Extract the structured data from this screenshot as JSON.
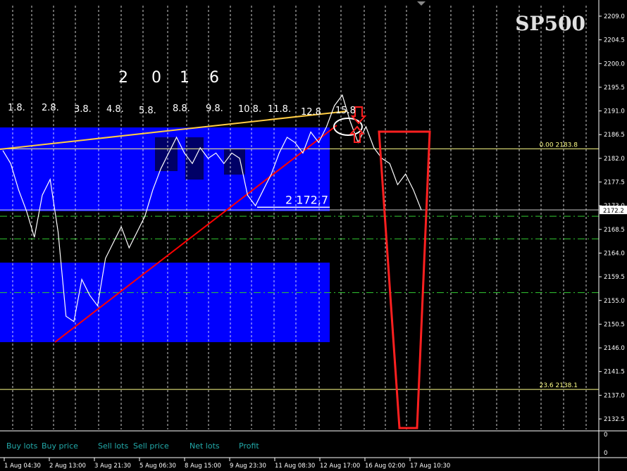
{
  "chart_data": {
    "type": "line",
    "symbol": "SP500",
    "year_label": [
      "2",
      "0",
      "1",
      "6"
    ],
    "ylim": [
      2130.5,
      2211.0
    ],
    "y_ticks": [
      2209.0,
      2204.5,
      2200.0,
      2195.5,
      2191.0,
      2186.5,
      2182.0,
      2177.5,
      2173.0,
      2168.5,
      2164.0,
      2159.5,
      2155.0,
      2150.5,
      2146.0,
      2141.5,
      2137.0,
      2132.5
    ],
    "current_price": "2172.2",
    "x_labels": [
      "1 Aug 04:30",
      "2 Aug 13:00",
      "3 Aug 21:30",
      "5 Aug 06:30",
      "8 Aug 15:00",
      "9 Aug 23:30",
      "11 Aug 08:30",
      "12 Aug 17:00",
      "16 Aug 02:00",
      "17 Aug 10:30"
    ],
    "date_marks": [
      "1.8.",
      "2.8.",
      "3.8.",
      "4.8.",
      "5.8.",
      "8.8.",
      "9.8.",
      "10.8.",
      "11.8.",
      "12.8",
      "15.8"
    ],
    "annotation_level": "2 172,7",
    "fib_levels": [
      {
        "ratio": "0.00",
        "price": "2183.8",
        "value": 2183.8
      },
      {
        "ratio": "23.6",
        "price": "2138.1",
        "value": 2138.1
      }
    ],
    "dashed_levels": [
      2171.0,
      2166.7,
      2156.5
    ],
    "series": [
      {
        "values": [
          2183.5,
          2181,
          2176,
          2172,
          2167,
          2175,
          2178,
          2168,
          2152,
          2151,
          2159,
          2156,
          2154,
          2163,
          2166,
          2169,
          2165,
          2168,
          2171,
          2176,
          2180,
          2183,
          2186,
          2183,
          2181,
          2184,
          2182,
          2183,
          2181,
          2183,
          2182,
          2175,
          2173,
          2176,
          2179,
          2183,
          2186,
          2185,
          2183,
          2187,
          2185,
          2188,
          2192,
          2194,
          2189,
          2185,
          2188,
          2184,
          2182,
          2181,
          2177,
          2179,
          2176,
          2172.2
        ]
      }
    ],
    "legend": [
      {
        "label": "Buy lots"
      },
      {
        "label": "Buy price"
      },
      {
        "label": "Sell lots"
      },
      {
        "label": "Sell price"
      },
      {
        "label": "Net lots"
      },
      {
        "label": "Profit"
      }
    ],
    "sub_axis_ticks": [
      "0",
      "0"
    ]
  },
  "colors": {
    "background": "#000000",
    "price_line": "#ffffff",
    "zone": "#0000ff",
    "trend_up": "#ff0000",
    "trend_top": "#ffcc44",
    "level": "#ffff88",
    "grid": "#ffffff",
    "dashed": "#33cc33",
    "annotation": "#ff2020",
    "legend_text": "#22aaaa"
  }
}
